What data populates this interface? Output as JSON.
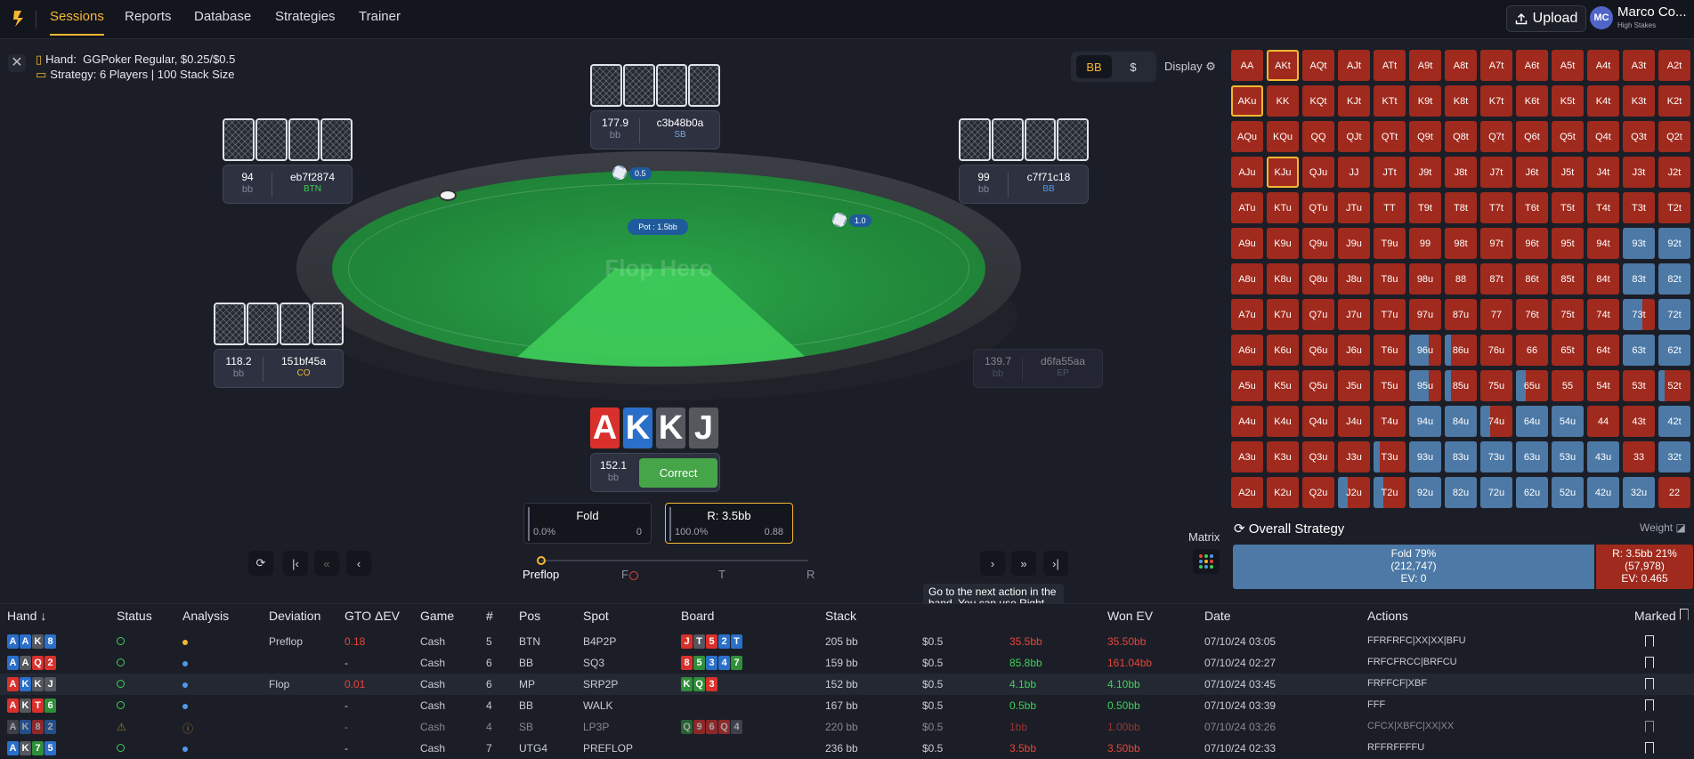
{
  "nav": {
    "tabs": [
      "Sessions",
      "Reports",
      "Database",
      "Strategies",
      "Trainer"
    ],
    "upload_label": "Upload",
    "user_initials": "MC",
    "user_name": "Marco Co...",
    "user_level": "High Stakes"
  },
  "hand": {
    "hand_label": "Hand:",
    "hand_value": "GGPoker Regular, $0.25/$0.5",
    "strategy_label": "Strategy:",
    "strategy_value": "6 Players | 100 Stack Size"
  },
  "display": {
    "unit_bb": "BB",
    "unit_dollar": "$",
    "display_label": "Display",
    "active_unit": "BB"
  },
  "table": {
    "logo_text": "Flop Hero",
    "pot_label": "Pot : 1.5bb",
    "sb_bet": "0.5",
    "bb_bet": "1.0",
    "seats": [
      {
        "key": "sb",
        "stack": "177.9",
        "unit": "bb",
        "name": "c3b48b0a",
        "pos": "SB",
        "pos_color": "#7aa6d8"
      },
      {
        "key": "btn",
        "stack": "94",
        "unit": "bb",
        "name": "eb7f2874",
        "pos": "BTN",
        "pos_color": "#3fcf5b"
      },
      {
        "key": "bb",
        "stack": "99",
        "unit": "bb",
        "name": "c7f71c18",
        "pos": "BB",
        "pos_color": "#4f9ae8"
      },
      {
        "key": "co",
        "stack": "118.2",
        "unit": "bb",
        "name": "151bf45a",
        "pos": "CO",
        "pos_color": "#f5b731"
      },
      {
        "key": "ep",
        "stack": "139.7",
        "unit": "bb",
        "name": "d6fa55aa",
        "pos": "EP",
        "pos_color": "#9aa0ad"
      }
    ],
    "hero": {
      "cards": [
        {
          "rank": "A",
          "suit_color": "#d9302b"
        },
        {
          "rank": "K",
          "suit_color": "#2a6fc9"
        },
        {
          "rank": "K",
          "suit_color": "#55585f"
        },
        {
          "rank": "J",
          "suit_color": "#55585f"
        }
      ],
      "stack": "152.1",
      "unit": "bb",
      "result": "Correct"
    }
  },
  "actions": {
    "fold": {
      "label": "Fold",
      "pct": "0.0%",
      "ev": "0"
    },
    "raise": {
      "label": "R: 3.5bb",
      "pct": "100.0%",
      "ev": "0.88"
    }
  },
  "streets": [
    "Preflop",
    "F",
    "T",
    "R"
  ],
  "tooltip": "Go to the next action in the hand. You can use Right arrow key instead.",
  "matrix": {
    "label": "Matrix",
    "colors": {
      "raise": "#a02a1d",
      "fold": "#4c79a6",
      "highlight": "#f5b731"
    },
    "rows": [
      [
        "AA",
        "AKt",
        "AQt",
        "AJt",
        "ATt",
        "A9t",
        "A8t",
        "A7t",
        "A6t",
        "A5t",
        "A4t",
        "A3t",
        "A2t"
      ],
      [
        "AKu",
        "KK",
        "KQt",
        "KJt",
        "KTt",
        "K9t",
        "K8t",
        "K7t",
        "K6t",
        "K5t",
        "K4t",
        "K3t",
        "K2t"
      ],
      [
        "AQu",
        "KQu",
        "QQ",
        "QJt",
        "QTt",
        "Q9t",
        "Q8t",
        "Q7t",
        "Q6t",
        "Q5t",
        "Q4t",
        "Q3t",
        "Q2t"
      ],
      [
        "AJu",
        "KJu",
        "QJu",
        "JJ",
        "JTt",
        "J9t",
        "J8t",
        "J7t",
        "J6t",
        "J5t",
        "J4t",
        "J3t",
        "J2t"
      ],
      [
        "ATu",
        "KTu",
        "QTu",
        "JTu",
        "TT",
        "T9t",
        "T8t",
        "T7t",
        "T6t",
        "T5t",
        "T4t",
        "T3t",
        "T2t"
      ],
      [
        "A9u",
        "K9u",
        "Q9u",
        "J9u",
        "T9u",
        "99",
        "98t",
        "97t",
        "96t",
        "95t",
        "94t",
        "93t",
        "92t"
      ],
      [
        "A8u",
        "K8u",
        "Q8u",
        "J8u",
        "T8u",
        "98u",
        "88",
        "87t",
        "86t",
        "85t",
        "84t",
        "83t",
        "82t"
      ],
      [
        "A7u",
        "K7u",
        "Q7u",
        "J7u",
        "T7u",
        "97u",
        "87u",
        "77",
        "76t",
        "75t",
        "74t",
        "73t",
        "72t"
      ],
      [
        "A6u",
        "K6u",
        "Q6u",
        "J6u",
        "T6u",
        "96u",
        "86u",
        "76u",
        "66",
        "65t",
        "64t",
        "63t",
        "62t"
      ],
      [
        "A5u",
        "K5u",
        "Q5u",
        "J5u",
        "T5u",
        "95u",
        "85u",
        "75u",
        "65u",
        "55",
        "54t",
        "53t",
        "52t"
      ],
      [
        "A4u",
        "K4u",
        "Q4u",
        "J4u",
        "T4u",
        "94u",
        "84u",
        "74u",
        "64u",
        "54u",
        "44",
        "43t",
        "42t"
      ],
      [
        "A3u",
        "K3u",
        "Q3u",
        "J3u",
        "T3u",
        "93u",
        "83u",
        "73u",
        "63u",
        "53u",
        "43u",
        "33",
        "32t"
      ],
      [
        "A2u",
        "K2u",
        "Q2u",
        "J2u",
        "T2u",
        "92u",
        "82u",
        "72u",
        "62u",
        "52u",
        "42u",
        "32u",
        "22"
      ]
    ],
    "fold_fraction": [
      [
        0,
        0,
        0,
        0,
        0,
        0,
        0,
        0,
        0,
        0,
        0,
        0,
        0
      ],
      [
        0,
        0,
        0,
        0,
        0,
        0,
        0,
        0,
        0,
        0,
        0,
        0,
        0
      ],
      [
        0,
        0,
        0,
        0,
        0,
        0,
        0,
        0,
        0,
        0,
        0,
        0,
        0
      ],
      [
        0,
        0,
        0,
        0,
        0,
        0,
        0,
        0,
        0,
        0,
        0,
        0,
        0
      ],
      [
        0,
        0,
        0,
        0,
        0,
        0,
        0,
        0,
        0,
        0,
        0,
        0,
        0
      ],
      [
        0,
        0,
        0,
        0,
        0,
        0,
        0,
        0,
        0,
        0,
        0,
        1,
        1
      ],
      [
        0,
        0,
        0,
        0,
        0,
        0,
        0,
        0,
        0,
        0,
        0,
        1,
        1
      ],
      [
        0,
        0,
        0,
        0,
        0,
        0,
        0,
        0,
        0,
        0,
        0,
        0.6,
        1
      ],
      [
        0,
        0,
        0,
        0,
        0,
        0.6,
        0.2,
        0,
        0,
        0,
        0,
        1,
        1
      ],
      [
        0,
        0,
        0,
        0,
        0,
        0.6,
        0.2,
        0,
        0.3,
        0,
        0,
        0,
        0.2
      ],
      [
        0,
        0,
        0,
        0,
        0,
        1,
        1,
        0.3,
        1,
        1,
        0,
        0,
        1
      ],
      [
        0,
        0,
        0,
        0,
        0.2,
        1,
        1,
        1,
        1,
        1,
        1,
        0,
        1
      ],
      [
        0,
        0,
        0,
        0.3,
        0.3,
        1,
        1,
        1,
        1,
        1,
        1,
        1,
        0
      ]
    ],
    "highlighted": [
      "AKt",
      "AKu",
      "KJu"
    ]
  },
  "overall": {
    "title": "Overall Strategy",
    "weight_label": "Weight",
    "fold": {
      "label": "Fold 79%",
      "combos": "(212,747)",
      "ev": "EV: 0",
      "fraction": 0.79
    },
    "raise": {
      "label": "R: 3.5bb 21%",
      "combos": "(57,978)",
      "ev": "EV: 0.465",
      "fraction": 0.21
    }
  },
  "history": {
    "headers": [
      "Hand",
      "Status",
      "Analysis",
      "Deviation",
      "GTO ΔEV",
      "Game",
      "#",
      "Pos",
      "Spot",
      "Board",
      "Stack",
      "",
      "",
      "Won EV",
      "Date",
      "Actions",
      "Marked"
    ],
    "rows": [
      {
        "cards": [
          {
            "r": "A",
            "c": "#2a6fc9"
          },
          {
            "r": "A",
            "c": "#2a6fc9"
          },
          {
            "r": "K",
            "c": "#55585f"
          },
          {
            "r": "8",
            "c": "#2a6fc9"
          }
        ],
        "analysis": "yellow",
        "deviation": "Preflop",
        "gto": "0.18",
        "gto_class": "red",
        "game": "Cash",
        "num": "5",
        "pos": "BTN",
        "spot": "B4P2P",
        "board": [
          {
            "r": "J",
            "c": "#d9302b"
          },
          {
            "r": "T",
            "c": "#55585f"
          },
          {
            "r": "5",
            "c": "#d9302b"
          },
          {
            "r": "2",
            "c": "#2a6fc9"
          },
          {
            "r": "T",
            "c": "#2a6fc9"
          }
        ],
        "stack": "205 bb",
        "blinds": "$0.5",
        "won": "35.5bb",
        "won_class": "red",
        "won_ev": "35.50bb",
        "won_ev_class": "red",
        "date": "07/10/24 03:05",
        "actions": "FFRFRFC|XX|XX|BFU"
      },
      {
        "cards": [
          {
            "r": "A",
            "c": "#2a6fc9"
          },
          {
            "r": "A",
            "c": "#55585f"
          },
          {
            "r": "Q",
            "c": "#d9302b"
          },
          {
            "r": "2",
            "c": "#d9302b"
          }
        ],
        "analysis": "blue",
        "deviation": "",
        "gto": "-",
        "gto_class": "",
        "game": "Cash",
        "num": "6",
        "pos": "BB",
        "spot": "SQ3",
        "board": [
          {
            "r": "8",
            "c": "#d9302b"
          },
          {
            "r": "5",
            "c": "#2f8f3a"
          },
          {
            "r": "3",
            "c": "#2a6fc9"
          },
          {
            "r": "4",
            "c": "#2a6fc9"
          },
          {
            "r": "7",
            "c": "#2f8f3a"
          }
        ],
        "stack": "159 bb",
        "blinds": "$0.5",
        "won": "85.8bb",
        "won_class": "green",
        "won_ev": "161.04bb",
        "won_ev_class": "red",
        "date": "07/10/24 02:27",
        "actions": "FRFCFRCC|BRFCU"
      },
      {
        "cards": [
          {
            "r": "A",
            "c": "#d9302b"
          },
          {
            "r": "K",
            "c": "#2a6fc9"
          },
          {
            "r": "K",
            "c": "#55585f"
          },
          {
            "r": "J",
            "c": "#55585f"
          }
        ],
        "analysis": "blue",
        "deviation": "Flop",
        "gto": "0.01",
        "gto_class": "red",
        "game": "Cash",
        "num": "6",
        "pos": "MP",
        "spot": "SRP2P",
        "board": [
          {
            "r": "K",
            "c": "#2f8f3a"
          },
          {
            "r": "Q",
            "c": "#2f8f3a"
          },
          {
            "r": "3",
            "c": "#d9302b"
          }
        ],
        "stack": "152 bb",
        "blinds": "$0.5",
        "won": "4.1bb",
        "won_class": "green",
        "won_ev": "4.10bb",
        "won_ev_class": "green",
        "date": "07/10/24 03:45",
        "actions": "FRFFCF|XBF"
      },
      {
        "cards": [
          {
            "r": "A",
            "c": "#d9302b"
          },
          {
            "r": "K",
            "c": "#55585f"
          },
          {
            "r": "T",
            "c": "#d9302b"
          },
          {
            "r": "6",
            "c": "#2f8f3a"
          }
        ],
        "analysis": "blue",
        "deviation": "",
        "gto": "-",
        "gto_class": "",
        "game": "Cash",
        "num": "4",
        "pos": "BB",
        "spot": "WALK",
        "board": [],
        "stack": "167 bb",
        "blinds": "$0.5",
        "won": "0.5bb",
        "won_class": "green",
        "won_ev": "0.50bb",
        "won_ev_class": "green",
        "date": "07/10/24 03:39",
        "actions": "FFF"
      },
      {
        "cards": [
          {
            "r": "A",
            "c": "#55585f"
          },
          {
            "r": "K",
            "c": "#2a6fc9"
          },
          {
            "r": "8",
            "c": "#d9302b"
          },
          {
            "r": "2",
            "c": "#2a6fc9"
          }
        ],
        "analysis": "warn",
        "deviation": "",
        "gto": "-",
        "gto_class": "",
        "game": "Cash",
        "num": "4",
        "pos": "SB",
        "spot": "LP3P",
        "board": [
          {
            "r": "Q",
            "c": "#2f8f3a"
          },
          {
            "r": "9",
            "c": "#d9302b"
          },
          {
            "r": "6",
            "c": "#d9302b"
          },
          {
            "r": "Q",
            "c": "#d9302b"
          },
          {
            "r": "4",
            "c": "#55585f"
          }
        ],
        "stack": "220 bb",
        "blinds": "$0.5",
        "won": "1bb",
        "won_class": "red",
        "won_ev": "1.00bb",
        "won_ev_class": "red",
        "date": "07/10/24 03:26",
        "actions": "CFCX|XBFC|XX|XX"
      },
      {
        "cards": [
          {
            "r": "A",
            "c": "#2a6fc9"
          },
          {
            "r": "K",
            "c": "#55585f"
          },
          {
            "r": "7",
            "c": "#2f8f3a"
          },
          {
            "r": "5",
            "c": "#2a6fc9"
          }
        ],
        "analysis": "blue",
        "deviation": "",
        "gto": "-",
        "gto_class": "",
        "game": "Cash",
        "num": "7",
        "pos": "UTG4",
        "spot": "PREFLOP",
        "board": [],
        "stack": "236 bb",
        "blinds": "$0.5",
        "won": "3.5bb",
        "won_class": "red",
        "won_ev": "3.50bb",
        "won_ev_class": "red",
        "date": "07/10/24 02:33",
        "actions": "RFFRFFFFU"
      }
    ]
  }
}
